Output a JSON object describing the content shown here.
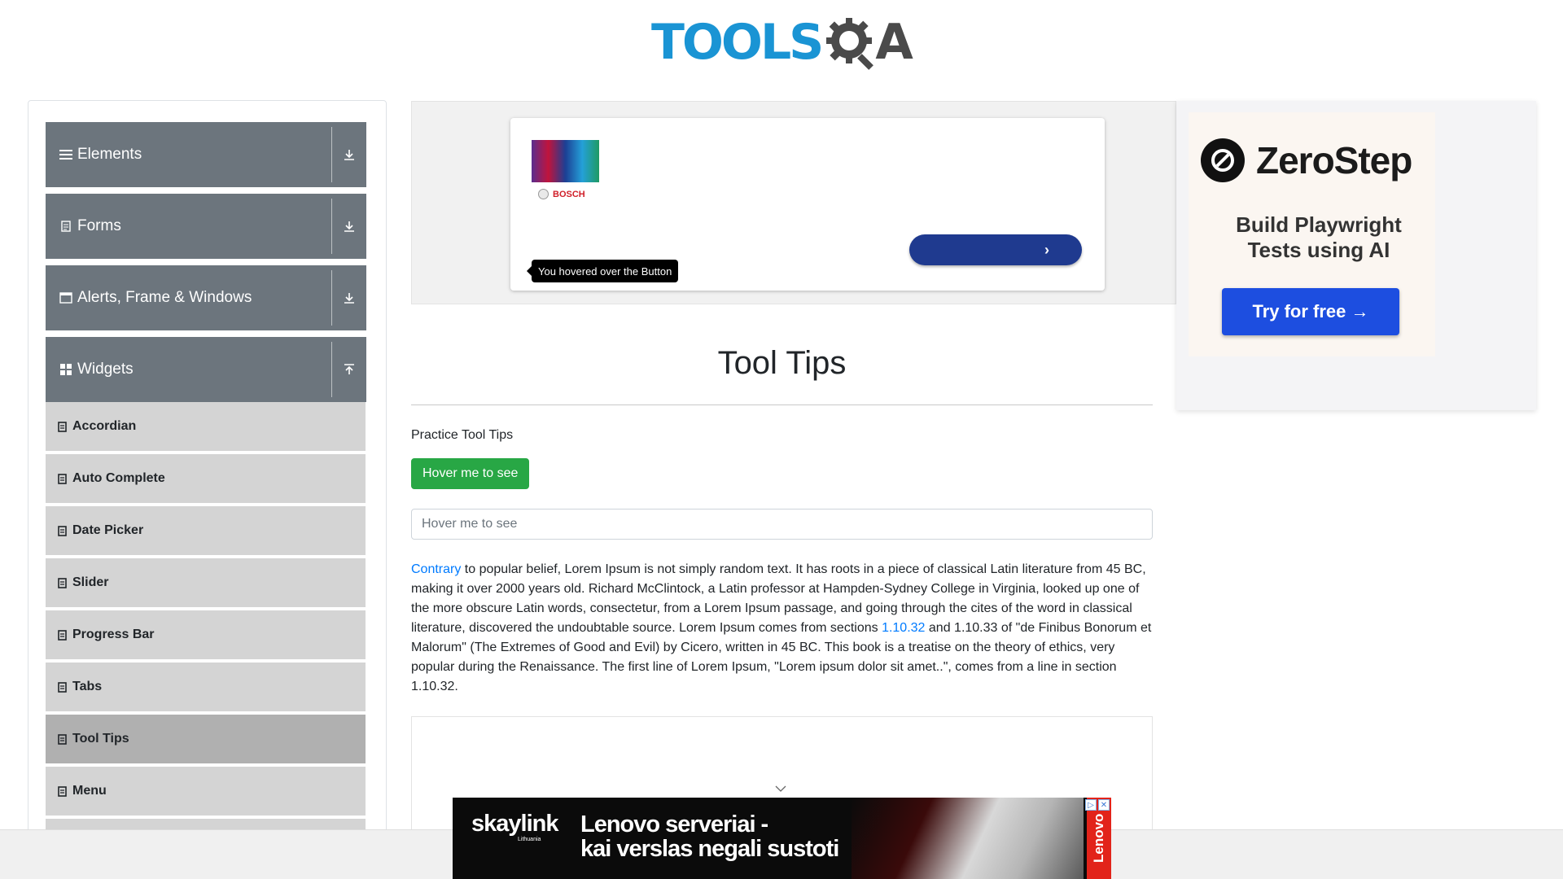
{
  "header": {
    "logo_tools": "TOOLS",
    "logo_qa": "QA"
  },
  "sidebar": {
    "groups": [
      {
        "label": "Elements",
        "icon": "hamburger-icon",
        "arrow": "download-arrow-icon"
      },
      {
        "label": "Forms",
        "icon": "document-icon",
        "arrow": "download-arrow-icon"
      },
      {
        "label": "Alerts, Frame & Windows",
        "icon": "window-icon",
        "arrow": "download-arrow-icon"
      },
      {
        "label": "Widgets",
        "icon": "widgets-grid-icon",
        "arrow": "upload-arrow-icon"
      }
    ],
    "widget_items": [
      {
        "label": "Accordian",
        "active": false
      },
      {
        "label": "Auto Complete",
        "active": false
      },
      {
        "label": "Date Picker",
        "active": false
      },
      {
        "label": "Slider",
        "active": false
      },
      {
        "label": "Progress Bar",
        "active": false
      },
      {
        "label": "Tabs",
        "active": false
      },
      {
        "label": "Tool Tips",
        "active": true
      },
      {
        "label": "Menu",
        "active": false
      }
    ]
  },
  "ad_top": {
    "brand": "BOSCH",
    "cta_icon": "›"
  },
  "tooltip": {
    "text": "You hovered over the Button"
  },
  "ad_right": {
    "brand": "ZeroStep",
    "tagline_1": "Build Playwright",
    "tagline_2": "Tests using AI",
    "cta": "Try for free →"
  },
  "main": {
    "title": "Tool Tips",
    "practice_label": "Practice Tool Tips",
    "hover_button": "Hover me to see",
    "hover_input_placeholder": "Hover me to see",
    "paragraph": {
      "link1": "Contrary",
      "part1": " to popular belief, Lorem Ipsum is not simply random text. It has roots in a piece of classical Latin literature from 45 BC, making it over 2000 years old. Richard McClintock, a Latin professor at Hampden-Sydney College in Virginia, looked up one of the more obscure Latin words, consectetur, from a Lorem Ipsum passage, and going through the cites of the word in classical literature, discovered the undoubtable source. Lorem Ipsum comes from sections ",
      "link2": "1.10.32",
      "part2": " and 1.10.33 of \"de Finibus Bonorum et Malorum\" (The Extremes of Good and Evil) by Cicero, written in 45 BC. This book is a treatise on the theory of ethics, very popular during the Renaissance. The first line of Lorem Ipsum, \"Lorem ipsum dolor sit amet..\", comes from a line in section 1.10.32."
    }
  },
  "bottom_ad": {
    "brand": "skaylink",
    "brand_sub": "Lithuania",
    "headline_1": "Lenovo serveriai -",
    "headline_2": "kai verslas negali sustoti",
    "side_brand": "Lenovo"
  },
  "colors": {
    "sidebar_group": "#6c757d",
    "menu_item": "#d4d4d4",
    "menu_active": "#b0b0b0",
    "success": "#28a745",
    "link": "#007bff",
    "logo_blue": "#1a94d4",
    "zerostep_button": "#1d4ee0"
  }
}
